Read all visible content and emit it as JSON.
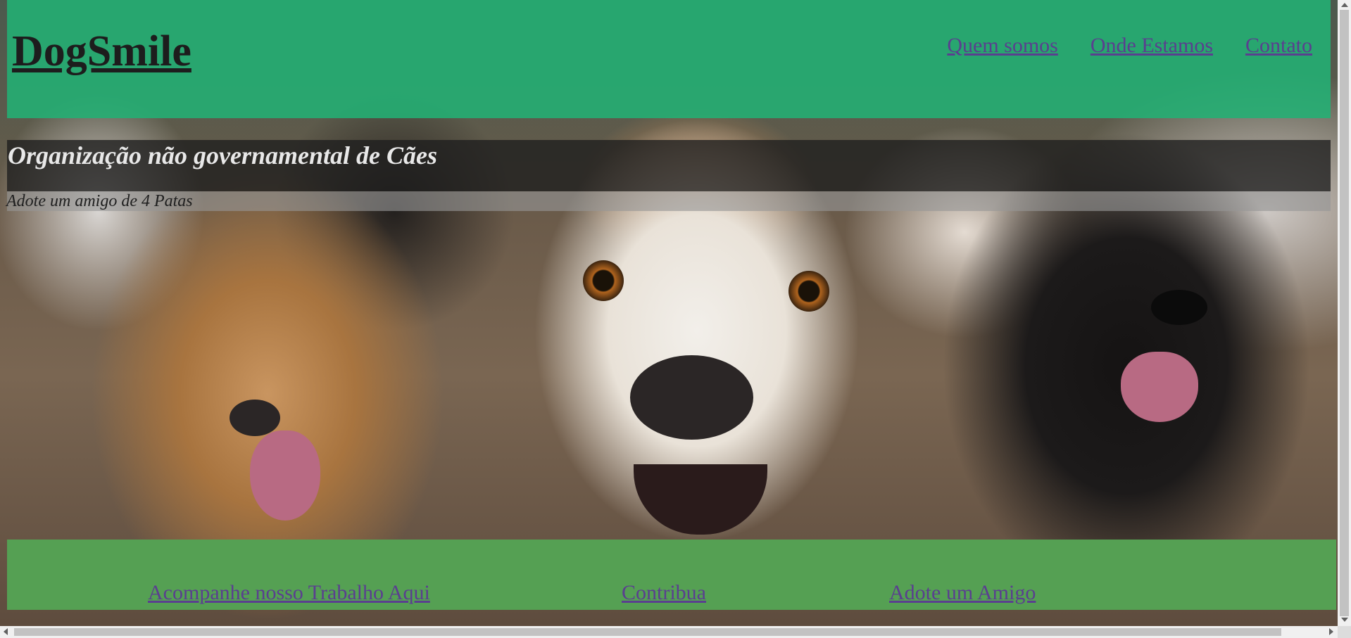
{
  "header": {
    "brand": "DogSmile",
    "nav": [
      "Quem somos",
      "Onde Estamos",
      "Contato"
    ],
    "background_color": "#22b074"
  },
  "hero": {
    "subtitle": "Organização não governamental de Cães",
    "tagline": "Adote um amigo de 4 Patas",
    "image_icon": "dogs-photo"
  },
  "footer": {
    "links": [
      "Acompanhe nosso Trabalho Aqui",
      "Contribua",
      "Adote um Amigo"
    ],
    "background_color": "#55a053"
  },
  "colors": {
    "link": "#5a3f8f"
  }
}
